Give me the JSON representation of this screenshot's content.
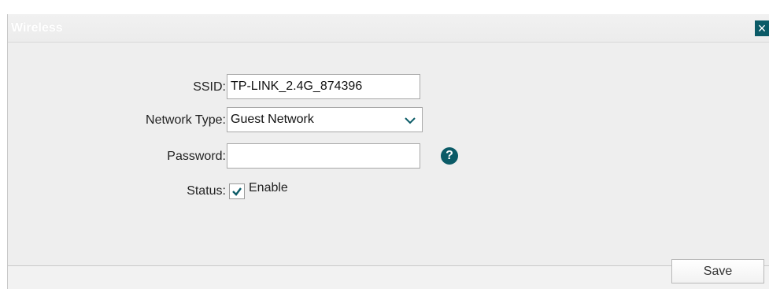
{
  "dialog": {
    "title": "Wireless",
    "close_icon": "close-icon"
  },
  "form": {
    "ssid": {
      "label": "SSID:",
      "value": "TP-LINK_2.4G_874396"
    },
    "network_type": {
      "label": "Network Type:",
      "selected": "Guest Network",
      "icon": "chevron-down-icon"
    },
    "password": {
      "label": "Password:",
      "value": "",
      "help_icon": "help-icon"
    },
    "status": {
      "label": "Status:",
      "checkbox_label": "Enable",
      "checked": true
    }
  },
  "actions": {
    "save_label": "Save"
  },
  "colors": {
    "accent": "#0b5b67",
    "panel_bg": "#eeeeee"
  }
}
